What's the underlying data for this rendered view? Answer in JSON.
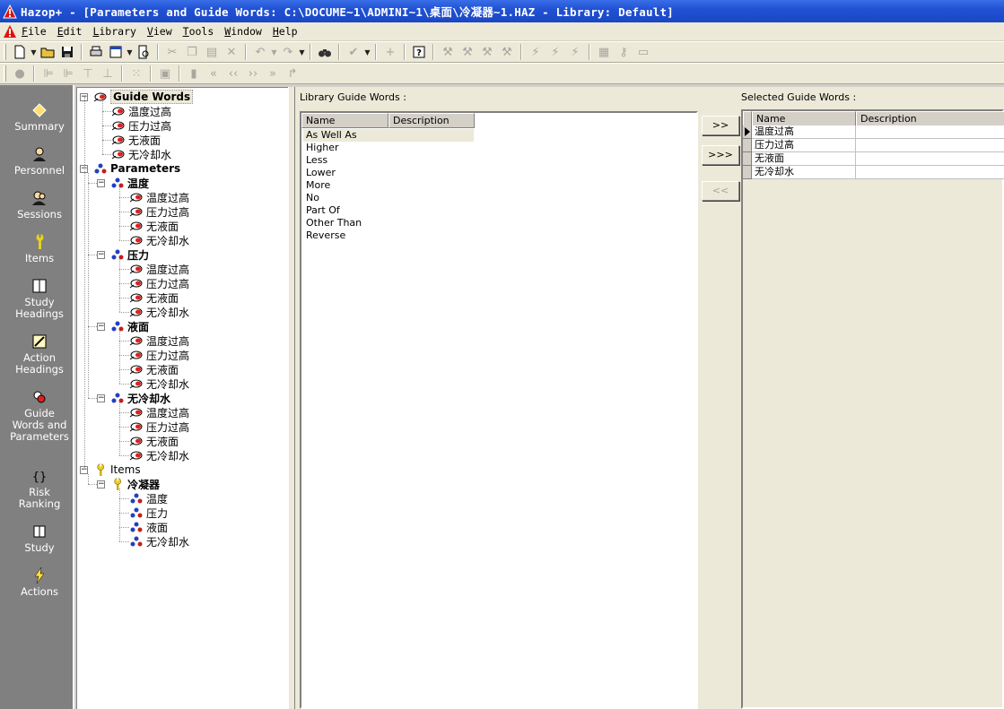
{
  "window": {
    "title": "Hazop+ - [Parameters and Guide Words: C:\\DOCUME~1\\ADMINI~1\\桌面\\冷凝器~1.HAZ - Library: Default]"
  },
  "menu": [
    {
      "ul": "F",
      "rest": "ile"
    },
    {
      "ul": "E",
      "rest": "dit"
    },
    {
      "ul": "L",
      "rest": "ibrary"
    },
    {
      "ul": "V",
      "rest": "iew"
    },
    {
      "ul": "T",
      "rest": "ools"
    },
    {
      "ul": "W",
      "rest": "indow"
    },
    {
      "ul": "H",
      "rest": "elp"
    }
  ],
  "nav": {
    "summary": "Summary",
    "personnel": "Personnel",
    "sessions": "Sessions",
    "items": "Items",
    "study_headings": [
      "Study",
      "Headings"
    ],
    "action_headings": [
      "Action",
      "Headings"
    ],
    "guide_words_params": [
      "Guide",
      "Words and",
      "Parameters"
    ],
    "risk_ranking": [
      "Risk",
      "Ranking"
    ],
    "study": "Study",
    "actions": "Actions"
  },
  "tree": {
    "guide_words_root": "Guide Words",
    "guide_words": [
      "温度过高",
      "压力过高",
      "无液面",
      "无冷却水"
    ],
    "parameters_root": "Parameters",
    "parameters": [
      {
        "name": "温度",
        "children": [
          "温度过高",
          "压力过高",
          "无液面",
          "无冷却水"
        ]
      },
      {
        "name": "压力",
        "children": [
          "温度过高",
          "压力过高",
          "无液面",
          "无冷却水"
        ]
      },
      {
        "name": "液面",
        "children": [
          "温度过高",
          "压力过高",
          "无液面",
          "无冷却水"
        ]
      },
      {
        "name": "无冷却水",
        "children": [
          "温度过高",
          "压力过高",
          "无液面",
          "无冷却水"
        ]
      }
    ],
    "items_root": "Items",
    "items": [
      {
        "name": "冷凝器",
        "children": [
          "温度",
          "压力",
          "液面",
          "无冷却水"
        ]
      }
    ]
  },
  "library": {
    "label": "Library Guide Words :",
    "columns": [
      "Name",
      "Description"
    ],
    "rows": [
      "As Well As",
      "Higher",
      "Less",
      "Lower",
      "More",
      "No",
      "Part Of",
      "Other Than",
      "Reverse"
    ]
  },
  "transfer": {
    "add": ">>",
    "add_all": ">>>",
    "remove": "<<"
  },
  "selected": {
    "label": "Selected Guide Words :",
    "columns": [
      "Name",
      "Description"
    ],
    "rows": [
      "温度过高",
      "压力过高",
      "无液面",
      "无冷却水"
    ]
  }
}
